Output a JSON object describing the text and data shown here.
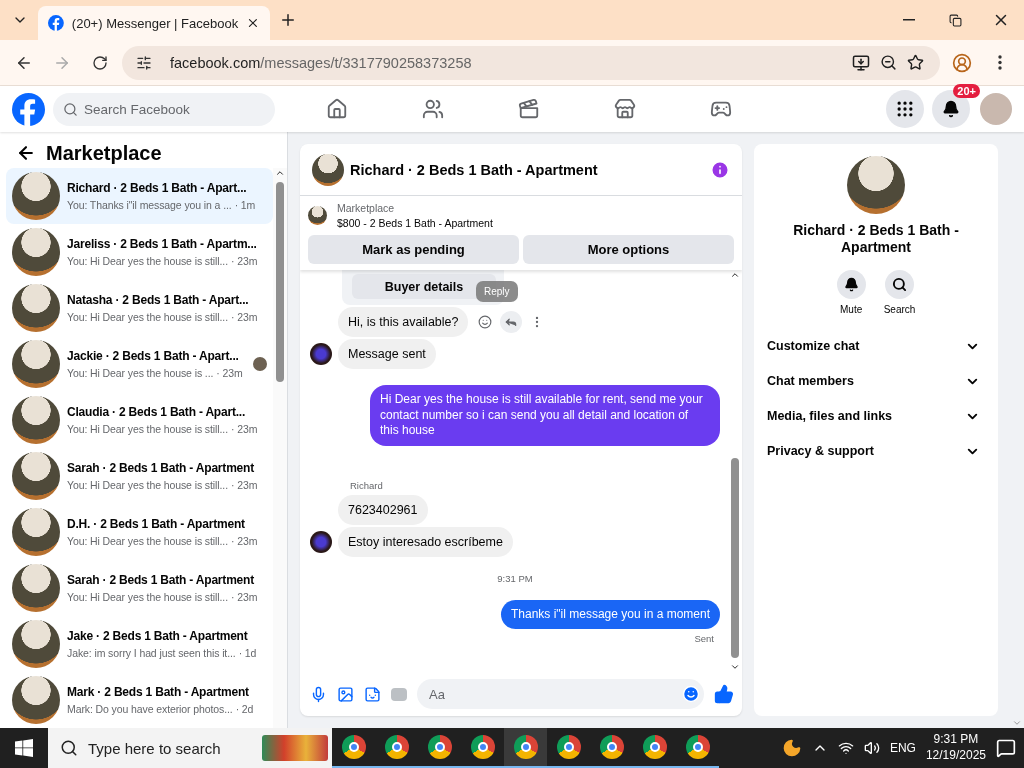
{
  "browser": {
    "tab_title": "(20+) Messenger | Facebook",
    "url_host": "facebook.com",
    "url_path": "/messages/t/3317790258373258"
  },
  "nav": {
    "search_placeholder": "Search Facebook",
    "notification_badge": "20+"
  },
  "sidebar": {
    "title": "Marketplace",
    "conversations": [
      {
        "name": "Richard · 2 Beds 1 Bath - Apart...",
        "preview": "You: Thanks i\"il message you in a ...",
        "time": "· 1m",
        "selected": true,
        "read_receipt": false
      },
      {
        "name": "Jareliss · 2 Beds 1 Bath - Apartm...",
        "preview": "You: Hi Dear yes the house is still...",
        "time": "· 23m",
        "selected": false,
        "read_receipt": false
      },
      {
        "name": "Natasha · 2 Beds 1 Bath - Apart...",
        "preview": "You: Hi Dear yes the house is still...",
        "time": "· 23m",
        "selected": false,
        "read_receipt": false
      },
      {
        "name": "Jackie · 2 Beds 1 Bath - Apart...",
        "preview": "You: Hi Dear yes the house is ...",
        "time": "· 23m",
        "selected": false,
        "read_receipt": true
      },
      {
        "name": "Claudia · 2 Beds 1 Bath - Apart...",
        "preview": "You: Hi Dear yes the house is still...",
        "time": "· 23m",
        "selected": false,
        "read_receipt": false
      },
      {
        "name": "Sarah · 2 Beds 1 Bath - Apartment",
        "preview": "You: Hi Dear yes the house is still...",
        "time": "· 23m",
        "selected": false,
        "read_receipt": false
      },
      {
        "name": "D.H. · 2 Beds 1 Bath - Apartment",
        "preview": "You: Hi Dear yes the house is still...",
        "time": "· 23m",
        "selected": false,
        "read_receipt": false
      },
      {
        "name": "Sarah · 2 Beds 1 Bath - Apartment",
        "preview": "You: Hi Dear yes the house is still...",
        "time": "· 23m",
        "selected": false,
        "read_receipt": false
      },
      {
        "name": "Jake · 2 Beds 1 Bath - Apartment",
        "preview": "Jake: im sorry I had just seen this it...",
        "time": "· 1d",
        "selected": false,
        "read_receipt": false
      },
      {
        "name": "Mark · 2 Beds 1 Bath - Apartment",
        "preview": "Mark: Do you have exterior photos...",
        "time": "· 2d",
        "selected": false,
        "read_receipt": false
      }
    ]
  },
  "chat": {
    "title": "Richard · 2 Beds 1 Bath - Apartment",
    "listing": {
      "source": "Marketplace",
      "title": "$800 - 2 Beds 1 Bath - Apartment"
    },
    "actions": [
      "Mark as pending",
      "More options"
    ],
    "messages": [
      {
        "kind": "card",
        "text": "Buyer details"
      },
      {
        "kind": "incoming",
        "text": "Hi, is this available?",
        "avatar": false,
        "hovered": true,
        "tooltip": "Reply"
      },
      {
        "kind": "incoming",
        "text": "Message sent",
        "avatar": true,
        "hovered": false
      },
      {
        "kind": "outgoing",
        "text": "Hi Dear yes the house is still available for rent, send me your contact number so i can send you all detail and location of this house",
        "color": "#6a3cf0"
      },
      {
        "kind": "sender",
        "text": "Richard"
      },
      {
        "kind": "incoming",
        "text": "7623402961",
        "avatar": false,
        "hovered": false
      },
      {
        "kind": "incoming",
        "text": "Estoy interesado escríbeme",
        "avatar": true,
        "hovered": false
      },
      {
        "kind": "timestamp",
        "text": "9:31 PM"
      },
      {
        "kind": "outgoing",
        "text": "Thanks i\"il message you in a moment",
        "color": "#1a66f5"
      },
      {
        "kind": "status",
        "text": "Sent"
      }
    ],
    "composer_placeholder": "Aa"
  },
  "details": {
    "name": "Richard · 2 Beds 1 Bath - Apartment",
    "buttons": [
      "Mute",
      "Search"
    ],
    "sections": [
      {
        "label": "Customize chat",
        "expanded": false
      },
      {
        "label": "Chat members",
        "expanded": false
      },
      {
        "label": "Media, files and links",
        "expanded": false
      },
      {
        "label": "Privacy & support",
        "expanded": false
      }
    ]
  },
  "taskbar": {
    "search_placeholder": "Type here to search",
    "language": "ENG",
    "time": "9:31 PM",
    "date": "12/19/2025"
  }
}
